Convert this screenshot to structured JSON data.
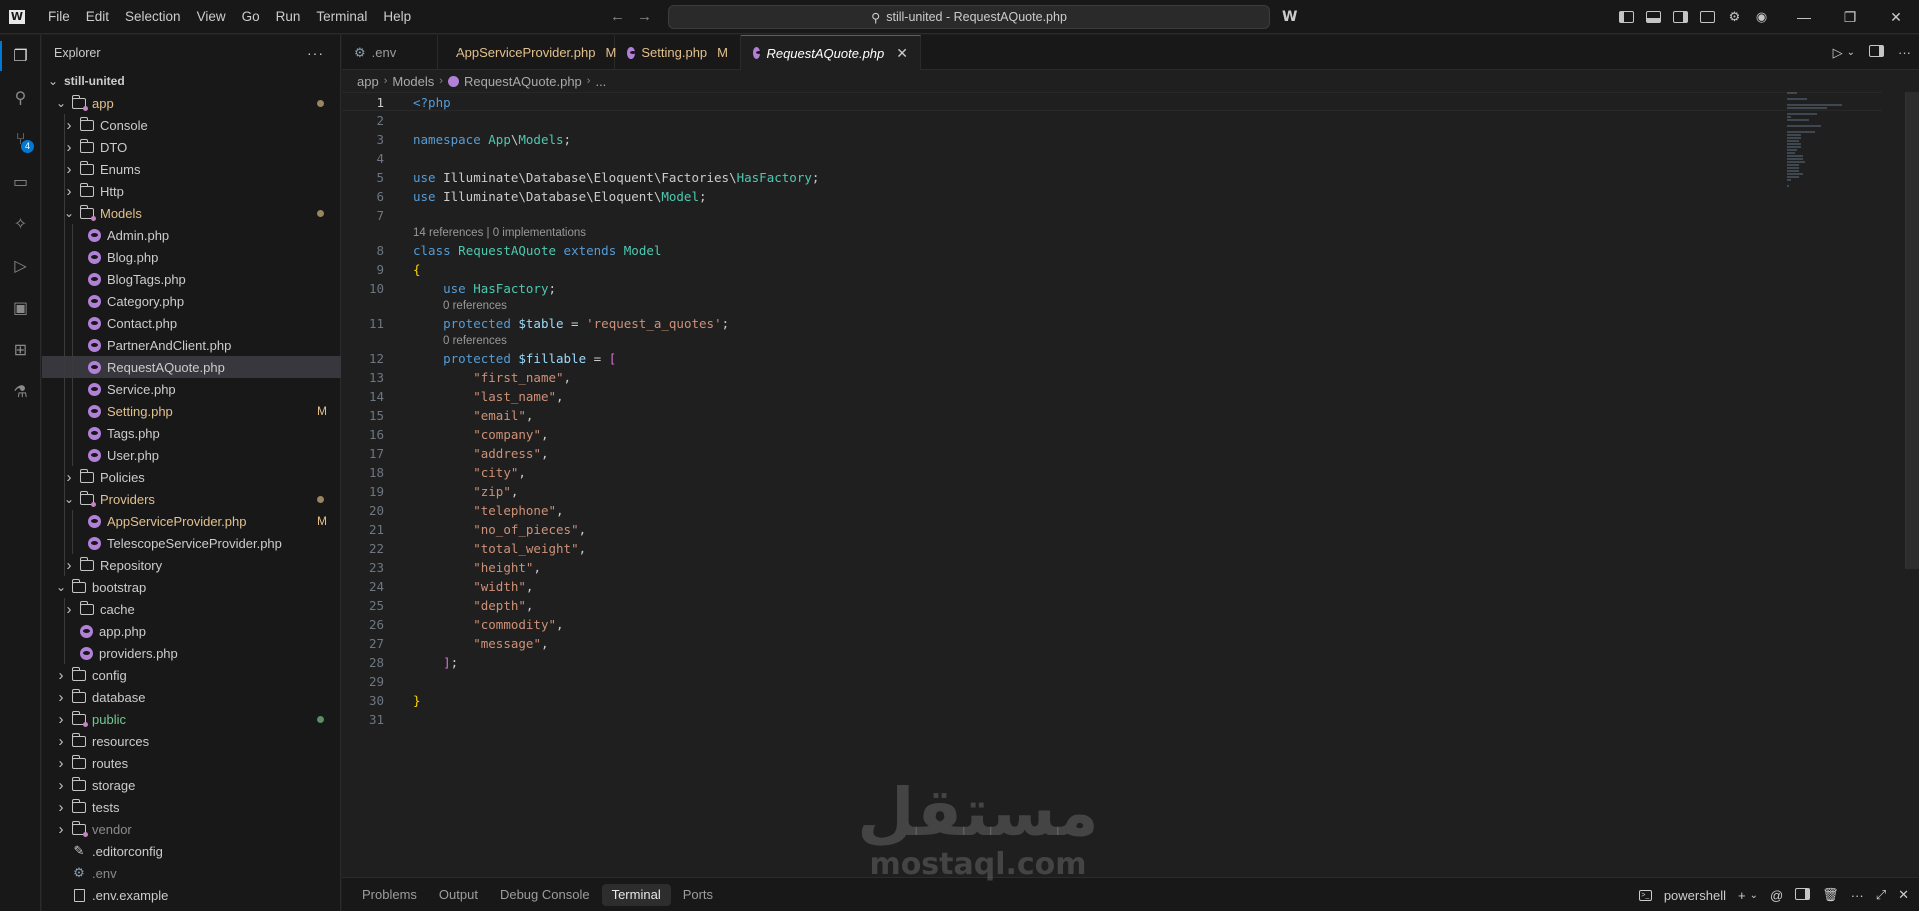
{
  "menu": [
    "File",
    "Edit",
    "Selection",
    "View",
    "Go",
    "Run",
    "Terminal",
    "Help"
  ],
  "command_center": {
    "text": "still-united - RequestAQuote.php",
    "icon": "search-icon"
  },
  "activity_bar": [
    {
      "name": "explorer-icon",
      "active": true
    },
    {
      "name": "search-icon"
    },
    {
      "name": "source-control-icon",
      "badge": "4"
    },
    {
      "name": "map-icon"
    },
    {
      "name": "run-debug-icon"
    },
    {
      "name": "testing-icon"
    },
    {
      "name": "remote-explorer-icon"
    },
    {
      "name": "extensions-icon"
    },
    {
      "name": "flask-icon"
    }
  ],
  "sidebar": {
    "title": "Explorer",
    "tree": [
      {
        "label": "still-united",
        "type": "root",
        "depth": 0,
        "open": true
      },
      {
        "label": "app",
        "type": "folder",
        "depth": 1,
        "open": true,
        "color": "mod",
        "deco": "dot-mod"
      },
      {
        "label": "Console",
        "type": "folder",
        "depth": 2
      },
      {
        "label": "DTO",
        "type": "folder",
        "depth": 2
      },
      {
        "label": "Enums",
        "type": "folder",
        "depth": 2
      },
      {
        "label": "Http",
        "type": "folder",
        "depth": 2
      },
      {
        "label": "Models",
        "type": "folder",
        "depth": 2,
        "open": true,
        "color": "mod",
        "deco": "dot-mod"
      },
      {
        "label": "Admin.php",
        "type": "php",
        "depth": 3
      },
      {
        "label": "Blog.php",
        "type": "php",
        "depth": 3
      },
      {
        "label": "BlogTags.php",
        "type": "php",
        "depth": 3
      },
      {
        "label": "Category.php",
        "type": "php",
        "depth": 3
      },
      {
        "label": "Contact.php",
        "type": "php",
        "depth": 3
      },
      {
        "label": "PartnerAndClient.php",
        "type": "php",
        "depth": 3
      },
      {
        "label": "RequestAQuote.php",
        "type": "php",
        "depth": 3,
        "selected": true
      },
      {
        "label": "Service.php",
        "type": "php",
        "depth": 3
      },
      {
        "label": "Setting.php",
        "type": "php",
        "depth": 3,
        "color": "mod",
        "deco": "M"
      },
      {
        "label": "Tags.php",
        "type": "php",
        "depth": 3
      },
      {
        "label": "User.php",
        "type": "php",
        "depth": 3
      },
      {
        "label": "Policies",
        "type": "folder",
        "depth": 2
      },
      {
        "label": "Providers",
        "type": "folder",
        "depth": 2,
        "open": true,
        "color": "mod",
        "deco": "dot-mod"
      },
      {
        "label": "AppServiceProvider.php",
        "type": "php",
        "depth": 3,
        "color": "mod",
        "deco": "M"
      },
      {
        "label": "TelescopeServiceProvider.php",
        "type": "php",
        "depth": 3
      },
      {
        "label": "Repository",
        "type": "folder",
        "depth": 2
      },
      {
        "label": "bootstrap",
        "type": "folder",
        "depth": 1,
        "open": true
      },
      {
        "label": "cache",
        "type": "folder",
        "depth": 2
      },
      {
        "label": "app.php",
        "type": "php",
        "depth": 2
      },
      {
        "label": "providers.php",
        "type": "php",
        "depth": 2
      },
      {
        "label": "config",
        "type": "folder",
        "depth": 1
      },
      {
        "label": "database",
        "type": "folder",
        "depth": 1
      },
      {
        "label": "public",
        "type": "folder",
        "depth": 1,
        "color": "green",
        "deco": "dot-green"
      },
      {
        "label": "resources",
        "type": "folder",
        "depth": 1
      },
      {
        "label": "routes",
        "type": "folder",
        "depth": 1
      },
      {
        "label": "storage",
        "type": "folder",
        "depth": 1
      },
      {
        "label": "tests",
        "type": "folder",
        "depth": 1
      },
      {
        "label": "vendor",
        "type": "folder",
        "depth": 1,
        "color": "dim"
      },
      {
        "label": ".editorconfig",
        "type": "config",
        "depth": 1
      },
      {
        "label": ".env",
        "type": "gear",
        "depth": 1,
        "color": "dim"
      },
      {
        "label": ".env.example",
        "type": "file",
        "depth": 1
      }
    ]
  },
  "tabs": [
    {
      "label": ".env",
      "icon": "gear"
    },
    {
      "label": "AppServiceProvider.php",
      "icon": "php",
      "status": "M"
    },
    {
      "label": "Setting.php",
      "icon": "php",
      "status": "M"
    },
    {
      "label": "RequestAQuote.php",
      "icon": "php",
      "active": true,
      "close": "✕"
    }
  ],
  "breadcrumb": [
    "app",
    "Models",
    "RequestAQuote.php",
    "..."
  ],
  "code": {
    "lenses": {
      "class": "14 references | 0 implementations",
      "table": "0 references",
      "fillable": "0 references"
    },
    "fillable": [
      "first_name",
      "last_name",
      "email",
      "company",
      "address",
      "city",
      "zip",
      "telephone",
      "no_of_pieces",
      "total_weight",
      "height",
      "width",
      "depth",
      "commodity",
      "message"
    ],
    "table_name": "request_a_quotes",
    "namespace": "App\\Models",
    "class_name": "RequestAQuote",
    "line_count": 31,
    "current_line": 1
  },
  "panel_tabs": [
    {
      "label": "Problems"
    },
    {
      "label": "Output"
    },
    {
      "label": "Debug Console"
    },
    {
      "label": "Terminal",
      "active": true
    },
    {
      "label": "Ports"
    }
  ],
  "terminal_shell": "powershell",
  "watermark": {
    "arabic": "مستقل",
    "latin": "mostaql.com"
  }
}
